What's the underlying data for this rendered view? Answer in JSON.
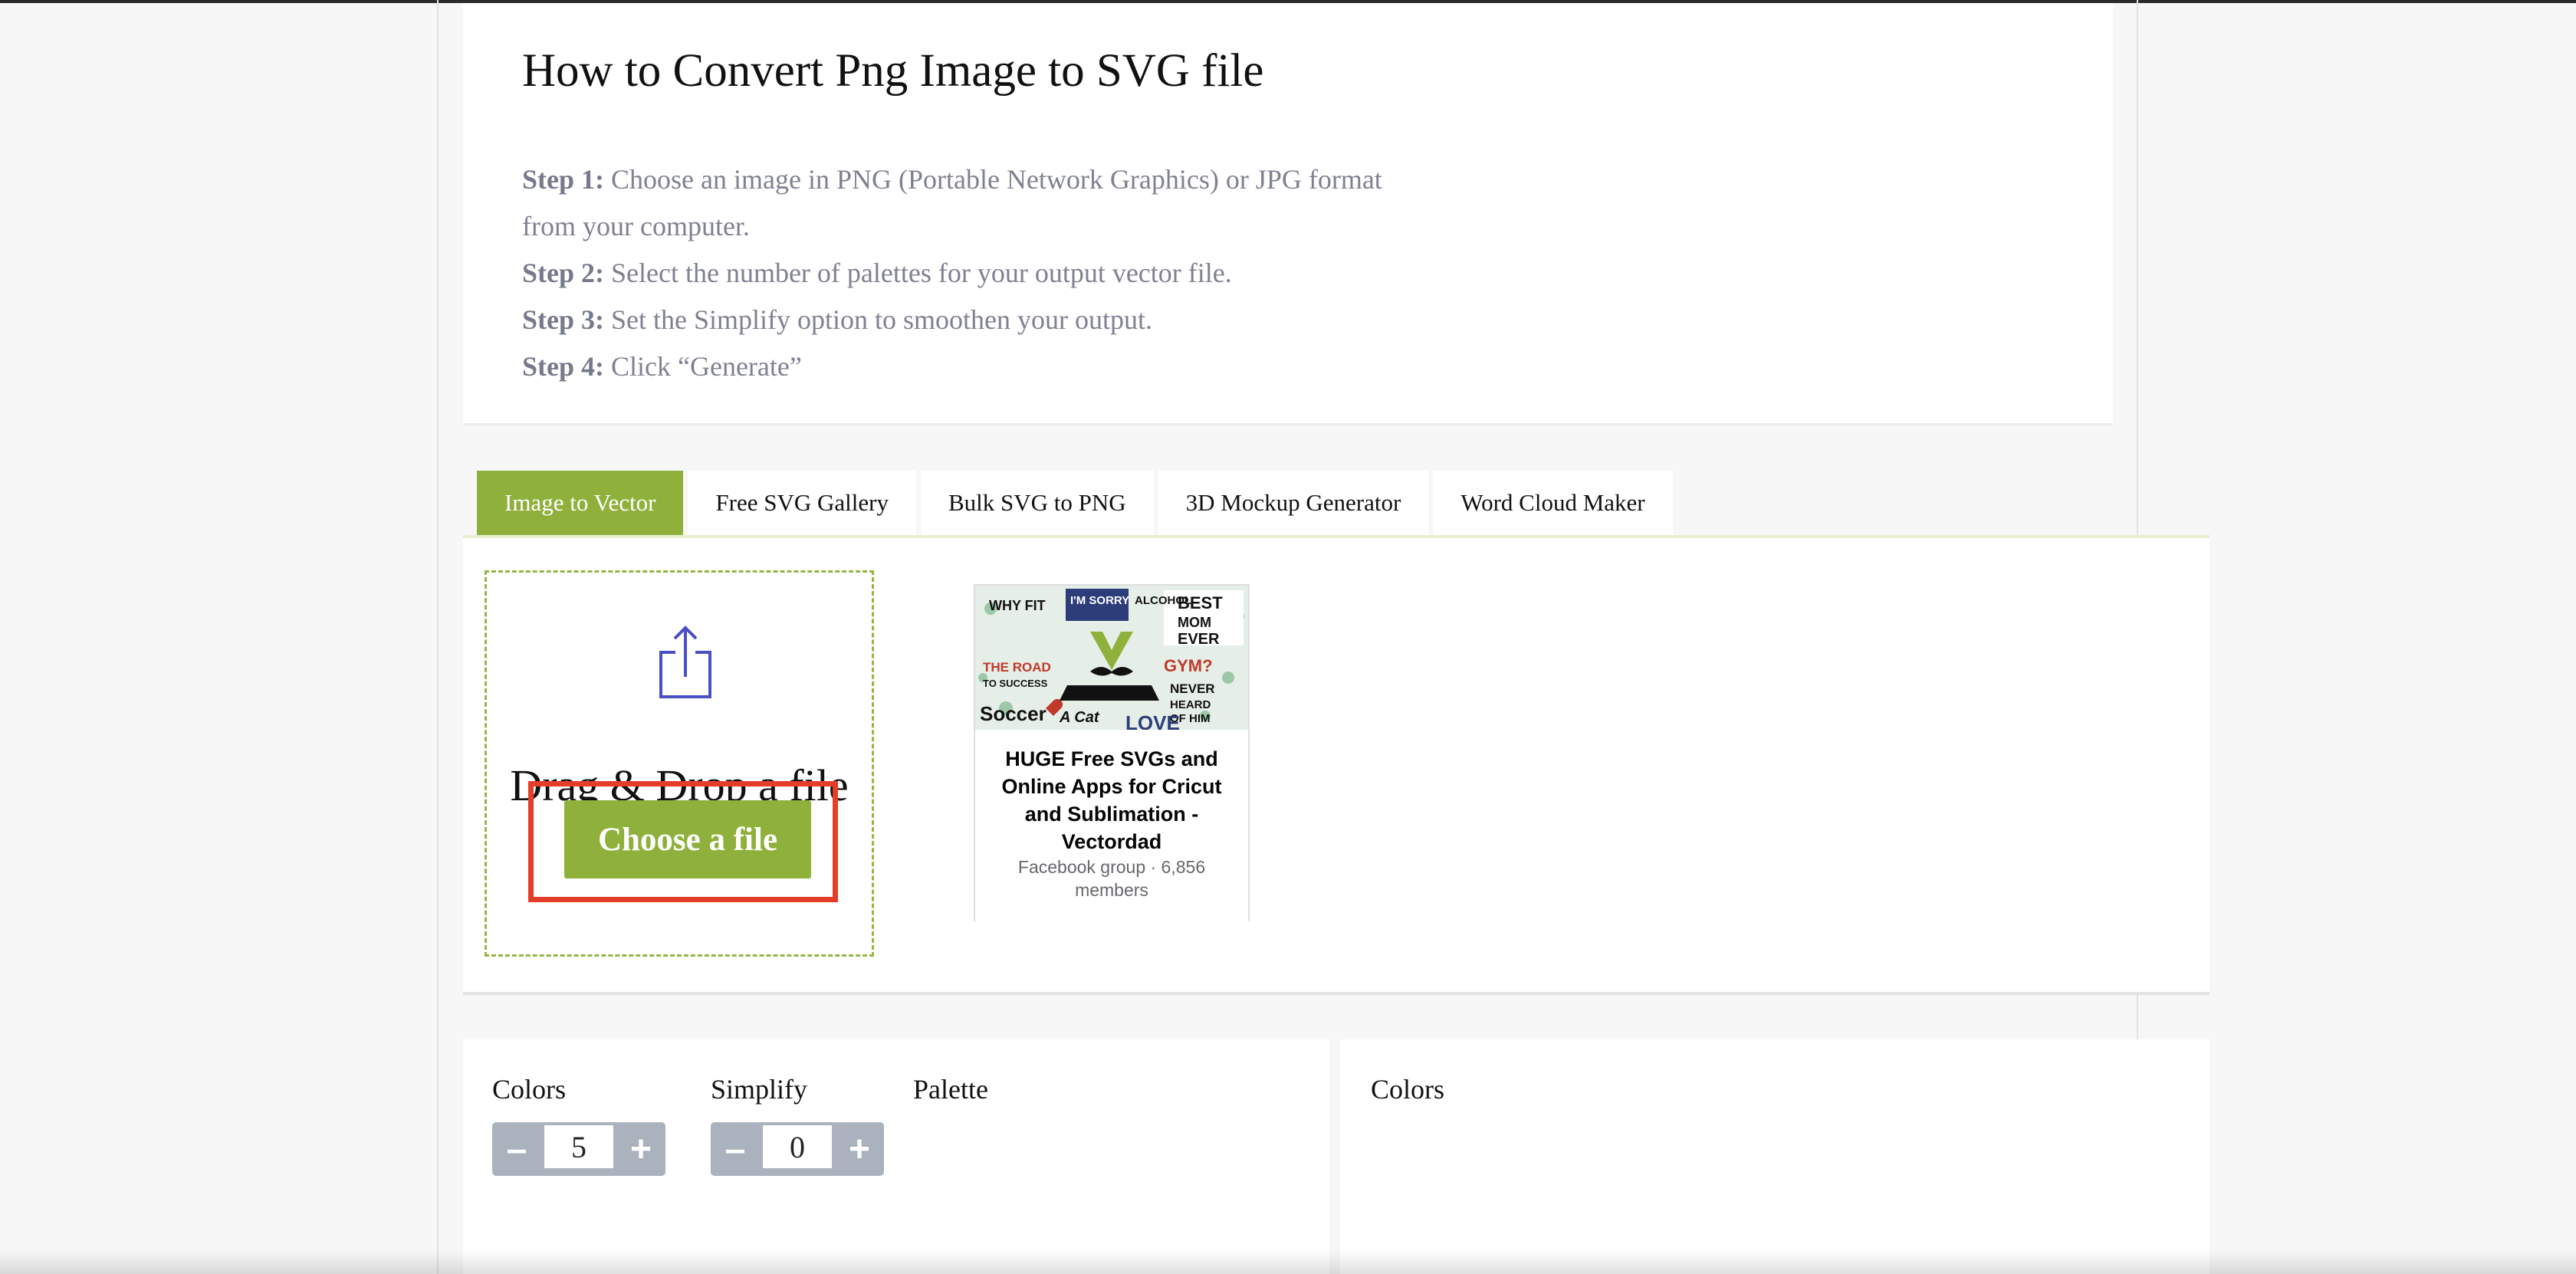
{
  "instructions": {
    "title": "How to Convert Png Image to SVG file",
    "steps": [
      {
        "label": "Step 1:",
        "text": " Choose an image in PNG (Portable Network Graphics) or JPG format from your computer."
      },
      {
        "label": "Step 2:",
        "text": " Select the number of palettes for your output vector file."
      },
      {
        "label": "Step 3:",
        "text": " Set the Simplify option to smoothen your output."
      },
      {
        "label": "Step 4:",
        "text": " Click “Generate”"
      }
    ]
  },
  "tabs": [
    {
      "label": "Image to Vector",
      "active": true
    },
    {
      "label": "Free SVG Gallery"
    },
    {
      "label": "Bulk SVG to PNG"
    },
    {
      "label": "3D Mockup Generator"
    },
    {
      "label": "Word Cloud Maker"
    }
  ],
  "upload": {
    "drag_text": "Drag & Drop a file",
    "choose_label": "Choose a file",
    "icon": "upload-icon",
    "accent_color": "#8fb13c",
    "highlight_color": "#e43d2a"
  },
  "facebook_card": {
    "title": "HUGE Free SVGs and Online Apps for Cricut and Sublimation - Vectordad",
    "meta": "Facebook group · 6,856 members",
    "cover_words": [
      "WHY FIT",
      "I'M SORRY",
      "ALCOHOL",
      "BEST MOM EVER",
      "THE ROAD TO SUCCESS",
      "GYM?",
      "NEVER HEARD OF HIM",
      "Soccer",
      "A Cat",
      "LOVE"
    ]
  },
  "settings": {
    "colors_label": "Colors",
    "colors_value": "5",
    "simplify_label": "Simplify",
    "simplify_value": "0",
    "palette_label": "Palette",
    "minus": "–",
    "plus": "+",
    "right_colors_label": "Colors"
  }
}
